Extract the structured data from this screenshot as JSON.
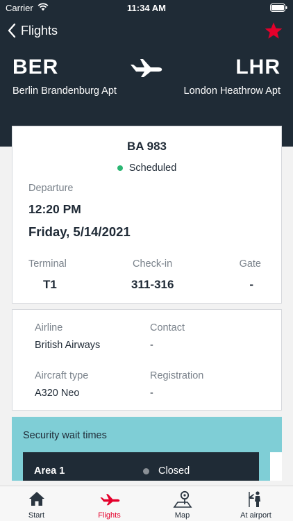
{
  "status_bar": {
    "carrier": "Carrier",
    "time": "11:34 AM"
  },
  "nav": {
    "back_label": "Flights",
    "favorite_icon": "star-icon",
    "accent_color": "#e4002b"
  },
  "route": {
    "from_code": "BER",
    "from_name": "Berlin Brandenburg Apt",
    "to_code": "LHR",
    "to_name": "London Heathrow Apt"
  },
  "flight": {
    "number": "BA 983",
    "status": "Scheduled",
    "status_color": "#2bb673",
    "departure_label": "Departure",
    "departure_time": "12:20 PM",
    "departure_date": "Friday, 5/14/2021",
    "terminal_label": "Terminal",
    "terminal": "T1",
    "checkin_label": "Check-in",
    "checkin": "311-316",
    "gate_label": "Gate",
    "gate": "-"
  },
  "details": {
    "airline_label": "Airline",
    "airline": "British Airways",
    "contact_label": "Contact",
    "contact": "-",
    "aircraft_label": "Aircraft type",
    "aircraft": "A320 Neo",
    "registration_label": "Registration",
    "registration": "-"
  },
  "security": {
    "title": "Security wait times",
    "areas": [
      {
        "name": "Area 1",
        "status": "Closed"
      }
    ]
  },
  "tabs": [
    {
      "label": "Start",
      "icon": "home-icon"
    },
    {
      "label": "Flights",
      "icon": "plane-icon",
      "active": true
    },
    {
      "label": "Map",
      "icon": "map-pin-icon"
    },
    {
      "label": "At airport",
      "icon": "traveler-icon"
    }
  ]
}
